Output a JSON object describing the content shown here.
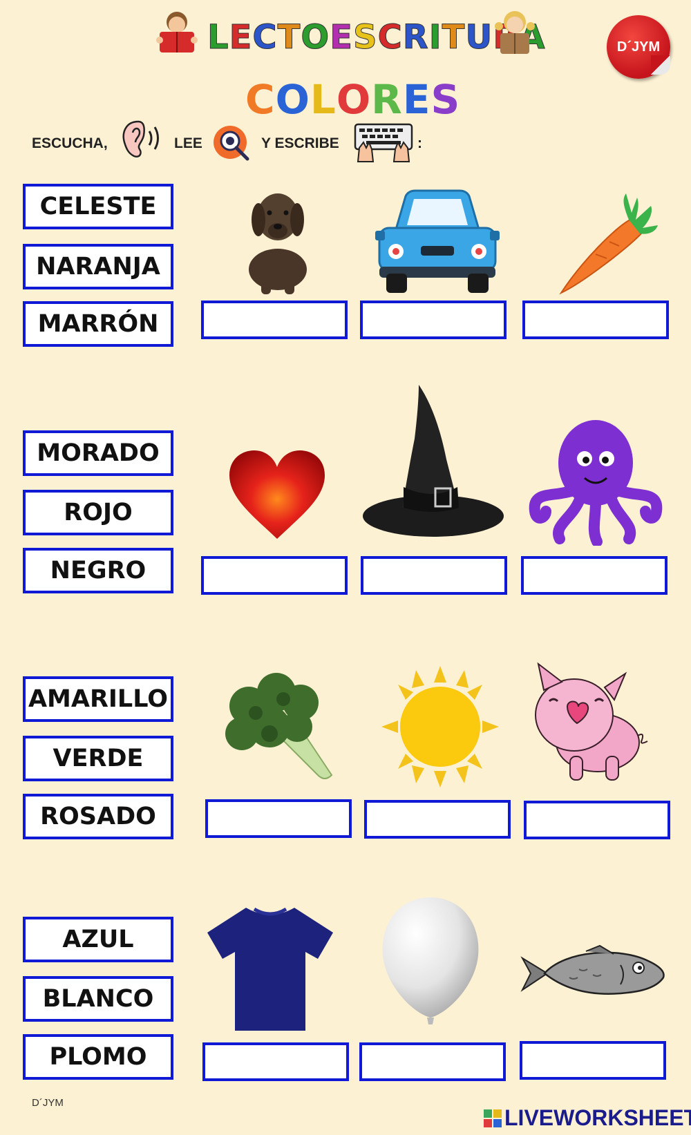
{
  "header": {
    "title": "LECTOESCRITURA",
    "subtitle": "COLORES",
    "badge": "D´JYM",
    "title_colors": [
      "#2a9d2e",
      "#d62b2b",
      "#2b55c9",
      "#e08a1a",
      "#2a9d2e",
      "#b42fb0",
      "#e6c21a",
      "#d62b2b",
      "#2b55c9",
      "#2a9d2e",
      "#e08a1a",
      "#2b55c9",
      "#d62b2b",
      "#2a9d2e"
    ],
    "subtitle_colors": [
      "#f07a26",
      "#2a63d6",
      "#e6b91a",
      "#e03a3a",
      "#5cb848",
      "#2a63d6",
      "#8a3dc9"
    ]
  },
  "instructions": {
    "listen": "ESCUCHA,",
    "read": "LEE",
    "write": "Y ESCRIBE",
    "colon": ":",
    "icons": [
      "ear-icon",
      "eye-magnifier-icon",
      "keyboard-hands-icon"
    ]
  },
  "groups": [
    {
      "words": [
        "CELESTE",
        "NARANJA",
        "MARRÓN"
      ],
      "pictures": [
        "puppy",
        "car",
        "carrot"
      ],
      "answers": [
        "",
        "",
        ""
      ]
    },
    {
      "words": [
        "MORADO",
        "ROJO",
        "NEGRO"
      ],
      "pictures": [
        "heart",
        "witch-hat",
        "octopus"
      ],
      "answers": [
        "",
        "",
        ""
      ]
    },
    {
      "words": [
        "AMARILLO",
        "VERDE",
        "ROSADO"
      ],
      "pictures": [
        "broccoli",
        "sun",
        "pig"
      ],
      "answers": [
        "",
        "",
        ""
      ]
    },
    {
      "words": [
        "AZUL",
        "BLANCO",
        "PLOMO"
      ],
      "pictures": [
        "t-shirt",
        "balloon",
        "fish"
      ],
      "answers": [
        "",
        "",
        ""
      ]
    }
  ],
  "footer": {
    "author": "D´JYM",
    "brand": "LIVEWORKSHEETS"
  },
  "colors": {
    "box_border": "#1019d6",
    "background": "#fdf1d3"
  }
}
